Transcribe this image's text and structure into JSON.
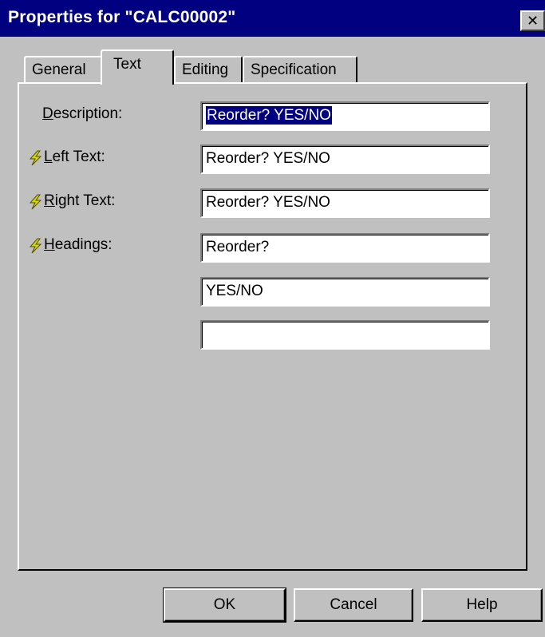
{
  "window": {
    "title": "Properties for \"CALC00002\"",
    "close_label": "✕"
  },
  "tabs": [
    {
      "label": "General",
      "active": false
    },
    {
      "label": "Text",
      "active": true
    },
    {
      "label": "Editing",
      "active": false
    },
    {
      "label": "Specification",
      "active": false
    }
  ],
  "fields": {
    "description": {
      "label_first": "D",
      "label_rest": "escription:",
      "value": "Reorder? YES/NO",
      "selected": true
    },
    "left_text": {
      "label_first": "L",
      "label_rest": "eft Text:",
      "value": "Reorder? YES/NO",
      "icon": "lightning-icon"
    },
    "right_text": {
      "label_first": "R",
      "label_rest": "ight Text:",
      "value": "Reorder? YES/NO",
      "icon": "lightning-icon"
    },
    "headings": {
      "label_first": "H",
      "label_rest": "eadings:",
      "values": [
        "Reorder?",
        "YES/NO",
        ""
      ],
      "icon": "lightning-icon"
    }
  },
  "buttons": {
    "ok": "OK",
    "cancel": "Cancel",
    "help": "Help"
  },
  "colors": {
    "titlebar": "#000080",
    "face": "#c0c0c0",
    "lightning": "#c8c800"
  }
}
